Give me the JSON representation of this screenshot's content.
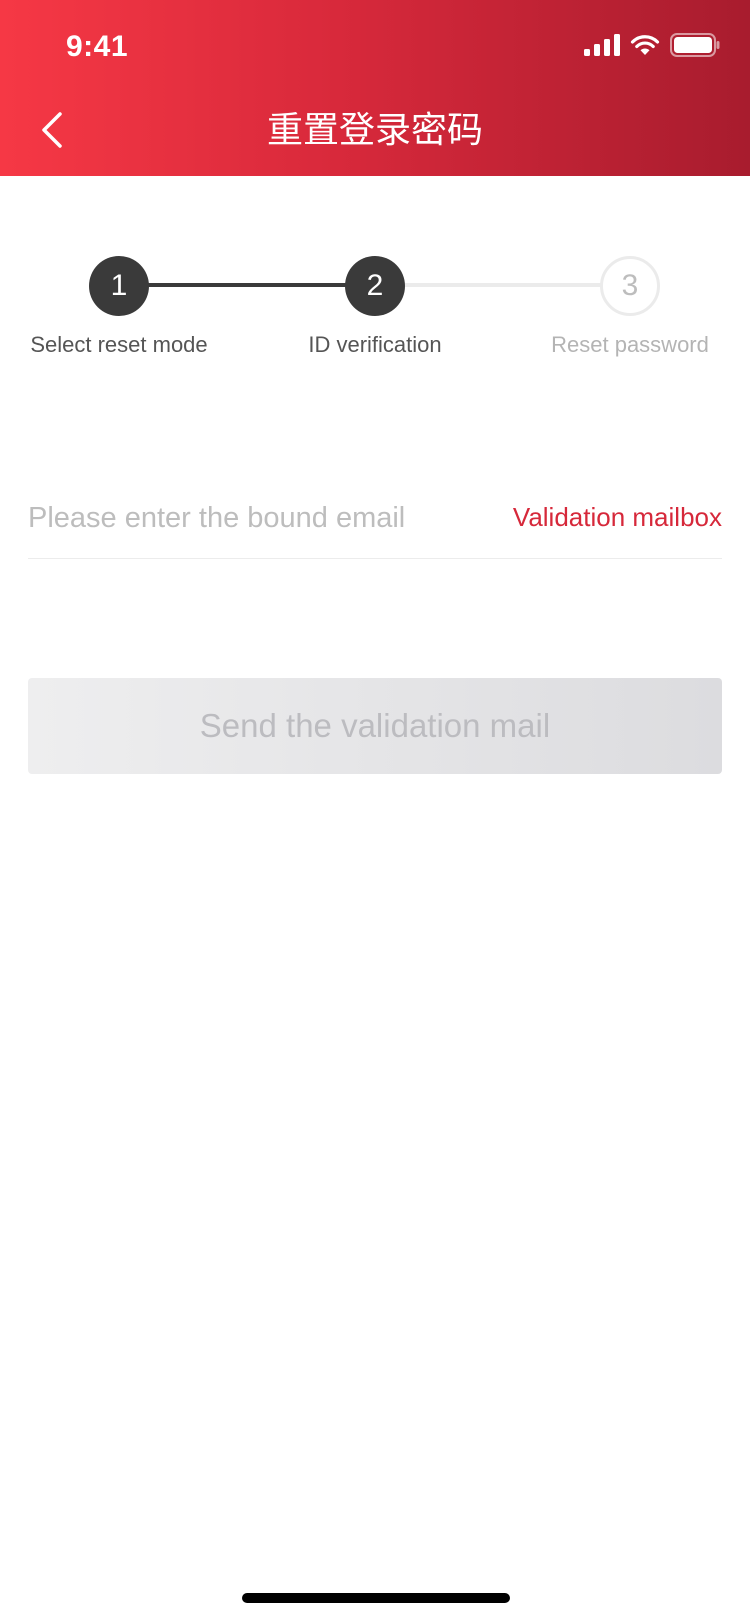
{
  "status_bar": {
    "time": "9:41"
  },
  "nav": {
    "title": "重置登录密码",
    "back_icon": "chevron-left-icon"
  },
  "stepper": {
    "steps": [
      {
        "number": "1",
        "label": "Select reset mode",
        "state": "completed"
      },
      {
        "number": "2",
        "label": "ID verification",
        "state": "current"
      },
      {
        "number": "3",
        "label": "Reset password",
        "state": "pending"
      }
    ]
  },
  "form": {
    "email_placeholder": "Please enter the bound email",
    "email_value": "",
    "validation_link": "Validation mailbox",
    "submit_label": "Send the validation mail",
    "submit_enabled": false
  },
  "colors": {
    "header_start": "#f63845",
    "header_end": "#a81c2e",
    "accent": "#d6283a",
    "step_active": "#3a3a3a"
  }
}
